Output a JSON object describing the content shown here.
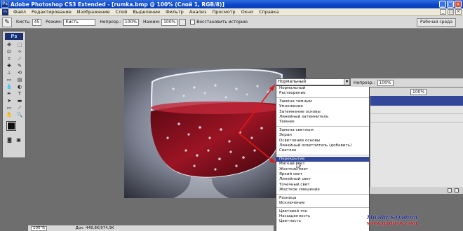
{
  "window": {
    "title": "Adobe Photoshop CS3 Extended - [rumka.bmp @ 100% (Слой 1, RGB/8)]",
    "app_icon": "Ps",
    "controls": [
      "_",
      "□",
      "×"
    ]
  },
  "menubar": {
    "items": [
      "Файл",
      "Редактирование",
      "Изображение",
      "Слой",
      "Выделение",
      "Фильтр",
      "Анализ",
      "Просмотр",
      "Окно",
      "Справка"
    ],
    "doc_controls": [
      "_",
      "□",
      "×"
    ]
  },
  "options": {
    "brush_label": "Кисть:",
    "brush_size": "45",
    "mode_label": "Режим:",
    "mode_value": "Кисть",
    "opacity_label": "Непрозр.:",
    "opacity_value": "100%",
    "flow_label": "Нажим:",
    "flow_value": "100%",
    "history_label": "Восстановить историю",
    "workspace_label": "Рабочая среда"
  },
  "toolbox": {
    "logo": "Ps"
  },
  "blend": {
    "current": "Нормальный",
    "groups": [
      [
        "Нормальный",
        "Растворение"
      ],
      [
        "Замена темным",
        "Умножение",
        "Затемнение основы",
        "Линейный затемнитель",
        "Темнее"
      ],
      [
        "Замена светлым",
        "Экран",
        "Осветление основы",
        "Линейный осветлитель (добавить)",
        "Светлее"
      ],
      [
        "Перекрытие",
        "Мягкий свет",
        "Жесткий свет",
        "Яркий свет",
        "Линейный свет",
        "Точечный свет",
        "Жесткое смешение"
      ],
      [
        "Разница",
        "Исключение"
      ],
      [
        "Цветовой тон",
        "Насыщенность",
        "Цветность"
      ]
    ],
    "selected": "Перекрытие"
  },
  "layers": {
    "opacity_label": "Непрозр.:",
    "opacity_value": "100%",
    "fill_value": "100%"
  },
  "status": {
    "zoom": "100 %",
    "doc": "Док: 448,8K/974,9K"
  },
  "watermark": {
    "author": "Müəllif:Ş.Qədirov",
    "site": "www.gadirov.com"
  },
  "colors": {
    "title_bar": "#0a46c8",
    "selection": "#33489a",
    "annotation_arrow": "#e01818"
  }
}
